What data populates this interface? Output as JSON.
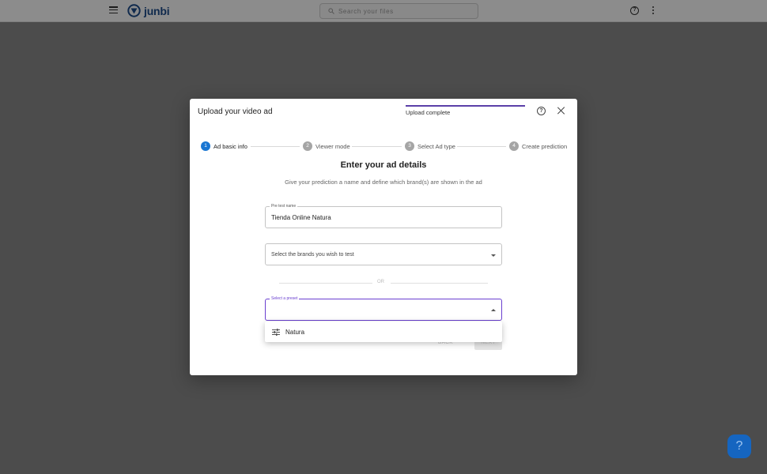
{
  "app": {
    "name": "junbi",
    "search_placeholder": "Search your files"
  },
  "dialog": {
    "title": "Upload your video ad",
    "upload_status": "Upload complete",
    "upload_progress": 1.0,
    "steps": [
      {
        "number": "1",
        "label": "Ad basic info",
        "active": true
      },
      {
        "number": "2",
        "label": "Viewer mode",
        "active": false
      },
      {
        "number": "3",
        "label": "Select Ad type",
        "active": false
      },
      {
        "number": "4",
        "label": "Create prediction",
        "active": false
      }
    ],
    "heading": "Enter your ad details",
    "subheading": "Give your prediction a name and define which brand(s) are shown in the ad",
    "pretest_name": {
      "label": "Pre test name",
      "value": "Tienda Online Natura"
    },
    "brands_select": {
      "placeholder": "Select the brands you wish to test"
    },
    "or_text": "OR",
    "preset_select": {
      "label": "Select a preset",
      "value": ""
    },
    "preset_options": [
      {
        "label": "Natura",
        "icon": "tune-icon"
      }
    ],
    "back_label": "BACK",
    "next_label": "NEXT"
  },
  "fab_label": "?",
  "colors": {
    "accent": "#6a3fd0",
    "progress": "#5b3fa8",
    "step_active": "#1976d2",
    "fab": "#1565c0",
    "brand": "#1e4d8c"
  }
}
